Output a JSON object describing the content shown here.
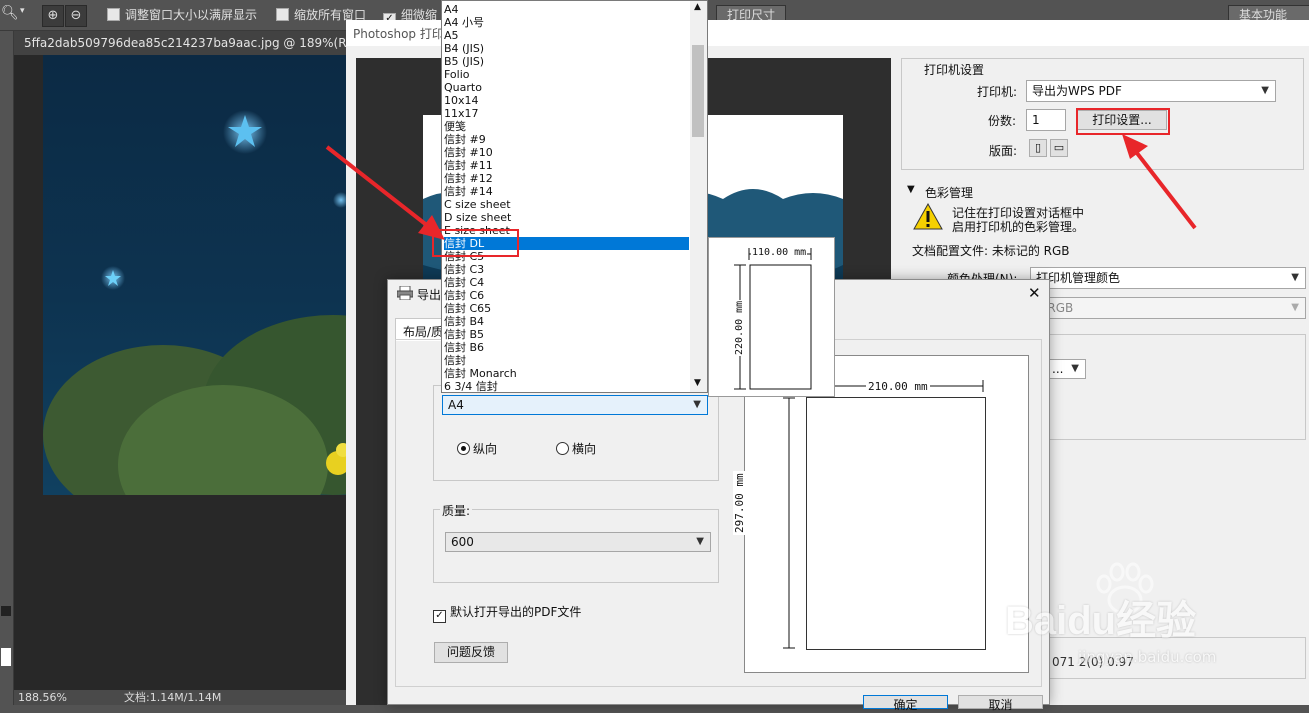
{
  "ps_toolbar": {
    "fit_window_label": "调整窗口大小以满屏显示",
    "zoom_all_label": "缩放所有窗口",
    "scrubby_label": "细微缩",
    "print_size_button": "打印尺寸",
    "workspace_label": "基本功能"
  },
  "document": {
    "tab_title": "5ffa2dab509796dea85c214237ba9aac.jpg @ 189%(RGB/8#",
    "zoom": "188.56%",
    "doc_size": "文档:1.14M/1.14M"
  },
  "print_dialog": {
    "title": "Photoshop 打印",
    "printer_section_title": "打印机设置",
    "printer_label": "打印机:",
    "printer_value": "导出为WPS PDF",
    "copies_label": "份数:",
    "copies_value": "1",
    "print_settings_button": "打印设置...",
    "layout_label": "版面:",
    "color_section_title": "色彩管理",
    "color_warning_line1": "记住在打印设置对话框中",
    "color_warning_line2": "启用打印机的色彩管理。",
    "doc_profile_label": "文档配置文件: 未标记的 RGB",
    "color_handling_label": "颜色处理(N):",
    "color_handling_value": "打印机管理颜色",
    "printer_profile_value": "E RGB",
    "bottom_vals": "071  2(0)  0.97"
  },
  "export_dialog": {
    "title": "导出",
    "tab_layout": "布局/质",
    "paper_value": "A4",
    "portrait_label": "纵向",
    "landscape_label": "横向",
    "quality_label": "质量:",
    "quality_value": "600",
    "open_pdf_label": "默认打开导出的PDF文件",
    "feedback_button": "问题反馈",
    "ok_button": "确定",
    "cancel_button": "取消",
    "page_width": "210.00 mm",
    "page_height": "297.00 mm",
    "envelope_width": "110.00 mm",
    "envelope_height": "220.00 mm"
  },
  "paper_list": {
    "items": [
      "A4",
      "A4 小号",
      "A5",
      "B4 (JIS)",
      "B5 (JIS)",
      "Folio",
      "Quarto",
      "10x14",
      "11x17",
      "便笺",
      "信封 #9",
      "信封 #10",
      "信封 #11",
      "信封 #12",
      "信封 #14",
      "C size sheet",
      "D size sheet",
      "E size sheet",
      "信封 DL",
      "信封 C5",
      "信封 C3",
      "信封 C4",
      "信封 C6",
      "信封 C65",
      "信封 B4",
      "信封 B5",
      "信封 B6",
      "信封",
      "信封 Monarch",
      "6 3/4 信封"
    ],
    "selected": "信封 DL"
  },
  "watermark": {
    "brand": "Baidu经验",
    "url": "jingyan.baidu.com"
  },
  "colors": {
    "selection": "#0078d7",
    "annotation": "#e8262a"
  }
}
